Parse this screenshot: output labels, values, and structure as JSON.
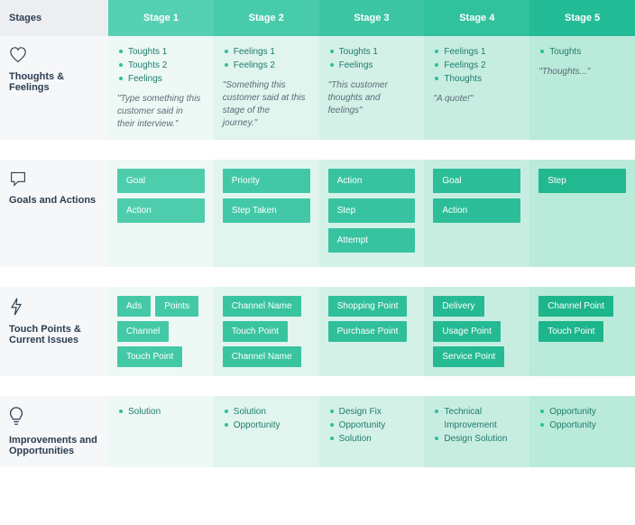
{
  "header": {
    "stages_label": "Stages",
    "cols": [
      "Stage 1",
      "Stage 2",
      "Stage 3",
      "Stage 4",
      "Stage 5"
    ]
  },
  "rows": {
    "thoughts": {
      "label": "Thoughts & Feelings",
      "cols": [
        {
          "bullets": [
            "Toughts 1",
            "Toughts 2",
            "Feelings"
          ],
          "quote": "\"Type something this customer said in their interview.\""
        },
        {
          "bullets": [
            "Feelings 1",
            "Feelings 2"
          ],
          "quote": "\"Something this customer said at this stage of the journey.\""
        },
        {
          "bullets": [
            "Toughts 1",
            "Feelings"
          ],
          "quote": "\"This customer thoughts and feelings\""
        },
        {
          "bullets": [
            "Feelings 1",
            "Feelings 2",
            "Thoughts"
          ],
          "quote": "\"A quote!\""
        },
        {
          "bullets": [
            "Toughts"
          ],
          "quote": "\"Thoughts...\""
        }
      ]
    },
    "goals": {
      "label": "Goals and Actions",
      "cols": [
        {
          "cards": [
            "Goal",
            "Action"
          ]
        },
        {
          "cards": [
            "Priority",
            "Step Taken"
          ]
        },
        {
          "cards": [
            "Action",
            "Step",
            "Attempt"
          ]
        },
        {
          "cards": [
            "Goal",
            "Action"
          ]
        },
        {
          "cards": [
            "Step"
          ]
        }
      ]
    },
    "touch": {
      "label": "Touch Points & Current Issues",
      "cols": [
        {
          "tags": [
            "Ads",
            "Points",
            "Channel",
            "Touch Point"
          ]
        },
        {
          "tags": [
            "Channel Name",
            "Touch Point",
            "Channel Name"
          ]
        },
        {
          "tags": [
            "Shopping Point",
            "Purchase Point"
          ]
        },
        {
          "tags": [
            "Delivery",
            "Usage Point",
            "Service Point"
          ]
        },
        {
          "tags": [
            "Channel Point",
            "Touch Point"
          ]
        }
      ]
    },
    "improve": {
      "label": "Improvements and Opportunities",
      "cols": [
        {
          "bullets": [
            "Solution"
          ]
        },
        {
          "bullets": [
            "Solution",
            "Opportunity"
          ]
        },
        {
          "bullets": [
            "Design Fix",
            "Opportunity",
            "Solution"
          ]
        },
        {
          "bullets": [
            "Technical Improvement",
            "Design Solution"
          ]
        },
        {
          "bullets": [
            "Opportunity",
            "Opportunity"
          ]
        }
      ]
    }
  }
}
